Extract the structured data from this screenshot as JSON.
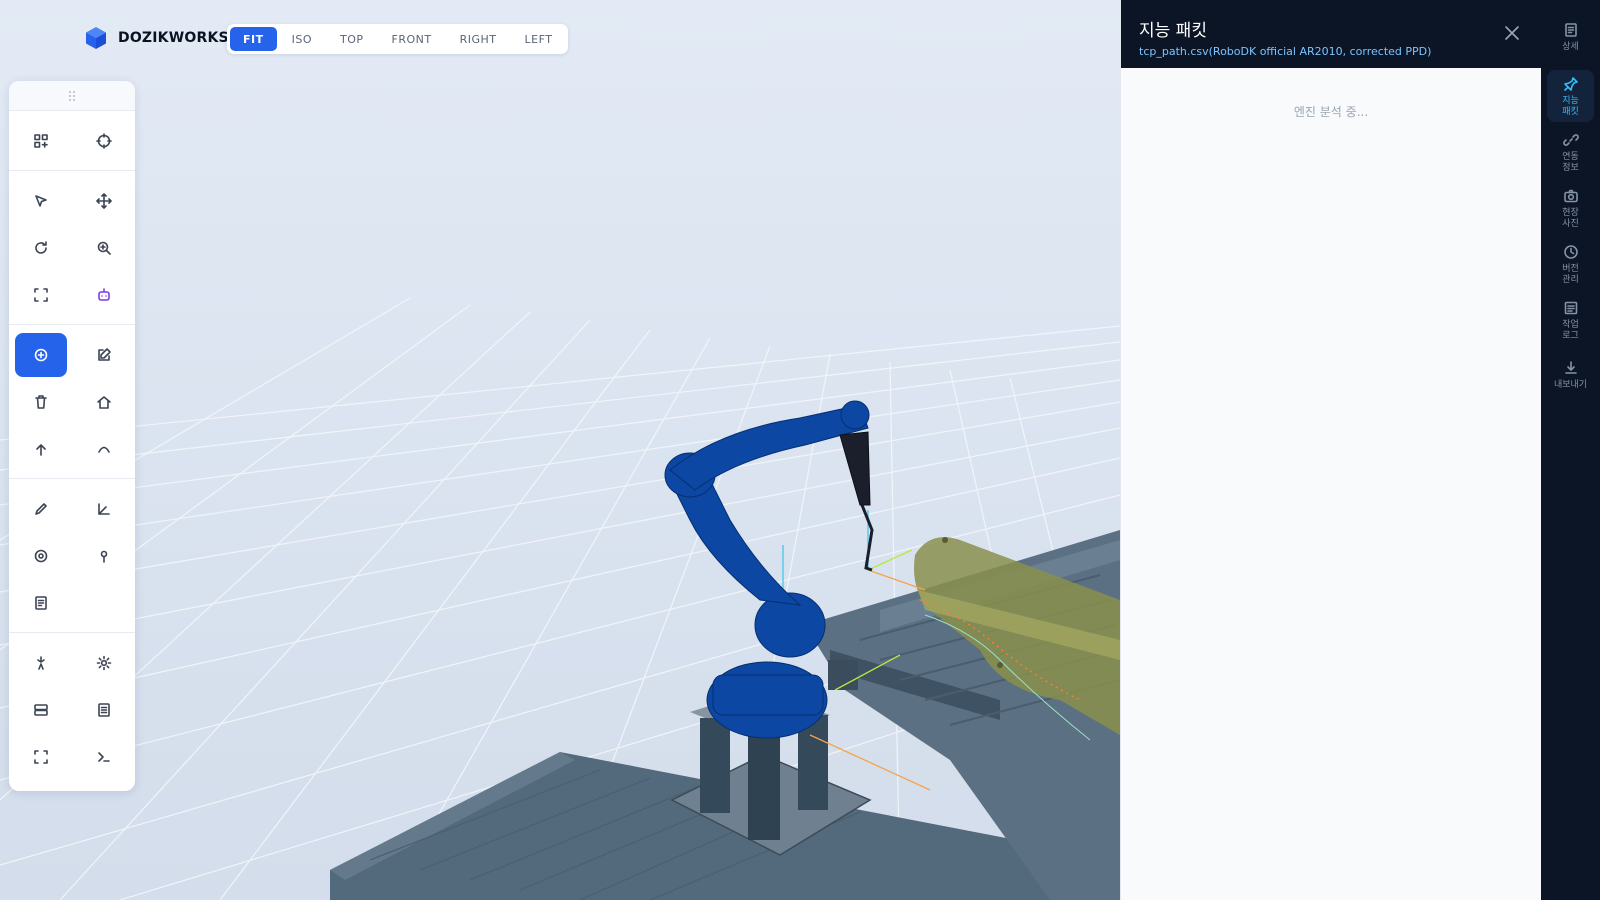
{
  "brand": {
    "name": "DOZIKWORKS",
    "logo_icon": "cube-logo-icon",
    "logo_color": "#2563eb"
  },
  "view_tabs": [
    {
      "label": "FIT",
      "active": true
    },
    {
      "label": "ISO",
      "active": false
    },
    {
      "label": "TOP",
      "active": false
    },
    {
      "label": "FRONT",
      "active": false
    },
    {
      "label": "RIGHT",
      "active": false
    },
    {
      "label": "LEFT",
      "active": false
    }
  ],
  "toolbar": {
    "groups": [
      [
        "add-grid-icon",
        "target-icon"
      ],
      [
        "pointer-icon",
        "move-icon",
        "rotate-icon",
        "zoom-in-icon",
        "frame-icon",
        "robot-icon"
      ],
      [
        "add-circle-icon",
        "edit-icon",
        "trash-icon",
        "home-icon",
        "arrow-up-icon",
        "chevron-up-icon"
      ],
      [
        "pencil-icon",
        "angle-icon",
        "record-icon",
        "pin-icon",
        "document-icon"
      ],
      [
        "sparkle-icon",
        "settings-icon",
        "storage-icon",
        "report-icon",
        "fullscreen-icon",
        "terminal-icon"
      ]
    ],
    "active_tool": "add-circle-icon"
  },
  "panel": {
    "title": "지능 패킷",
    "subtitle": "tcp_path.csv(RoboDK official AR2010, corrected PPD)",
    "status": "엔진 분석 중...",
    "close_icon": "close-icon"
  },
  "rail": [
    {
      "icon": "detail-icon",
      "label": "상세",
      "active": false
    },
    {
      "icon": "pin-icon",
      "label": "지능 패킷",
      "active": true
    },
    {
      "icon": "link-icon",
      "label": "연동 정보",
      "active": false
    },
    {
      "icon": "camera-icon",
      "label": "현장 사진",
      "active": false
    },
    {
      "icon": "history-icon",
      "label": "버전 관리",
      "active": false
    },
    {
      "icon": "log-icon",
      "label": "작업 로그",
      "active": false
    },
    {
      "icon": "download-icon",
      "label": "내보내기",
      "active": false
    }
  ],
  "colors": {
    "accent": "#2563eb",
    "robot": "#0b47a3",
    "rail_active": "#38bdf8",
    "panel_header": "#0b1526"
  }
}
